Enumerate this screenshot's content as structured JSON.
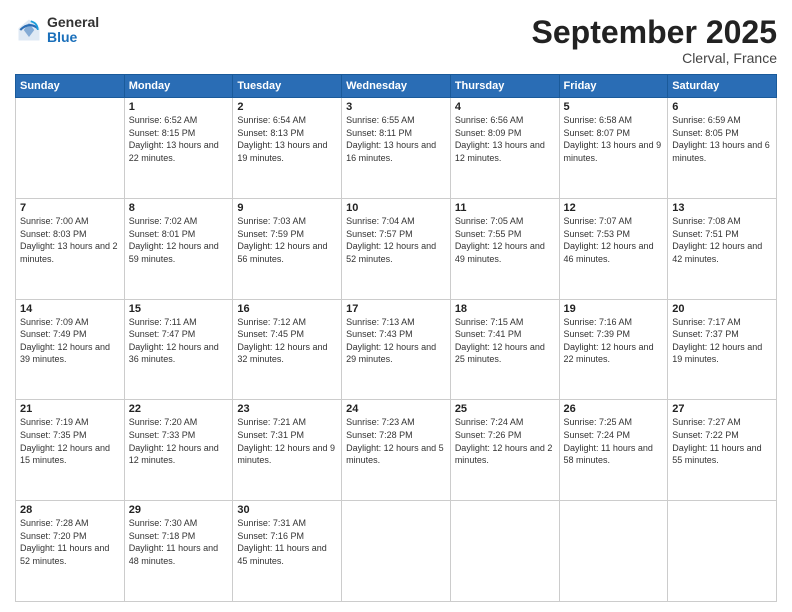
{
  "logo": {
    "general": "General",
    "blue": "Blue"
  },
  "header": {
    "month": "September 2025",
    "location": "Clerval, France"
  },
  "weekdays": [
    "Sunday",
    "Monday",
    "Tuesday",
    "Wednesday",
    "Thursday",
    "Friday",
    "Saturday"
  ],
  "weeks": [
    [
      {
        "day": "",
        "sunrise": "",
        "sunset": "",
        "daylight": ""
      },
      {
        "day": "1",
        "sunrise": "Sunrise: 6:52 AM",
        "sunset": "Sunset: 8:15 PM",
        "daylight": "Daylight: 13 hours and 22 minutes."
      },
      {
        "day": "2",
        "sunrise": "Sunrise: 6:54 AM",
        "sunset": "Sunset: 8:13 PM",
        "daylight": "Daylight: 13 hours and 19 minutes."
      },
      {
        "day": "3",
        "sunrise": "Sunrise: 6:55 AM",
        "sunset": "Sunset: 8:11 PM",
        "daylight": "Daylight: 13 hours and 16 minutes."
      },
      {
        "day": "4",
        "sunrise": "Sunrise: 6:56 AM",
        "sunset": "Sunset: 8:09 PM",
        "daylight": "Daylight: 13 hours and 12 minutes."
      },
      {
        "day": "5",
        "sunrise": "Sunrise: 6:58 AM",
        "sunset": "Sunset: 8:07 PM",
        "daylight": "Daylight: 13 hours and 9 minutes."
      },
      {
        "day": "6",
        "sunrise": "Sunrise: 6:59 AM",
        "sunset": "Sunset: 8:05 PM",
        "daylight": "Daylight: 13 hours and 6 minutes."
      }
    ],
    [
      {
        "day": "7",
        "sunrise": "Sunrise: 7:00 AM",
        "sunset": "Sunset: 8:03 PM",
        "daylight": "Daylight: 13 hours and 2 minutes."
      },
      {
        "day": "8",
        "sunrise": "Sunrise: 7:02 AM",
        "sunset": "Sunset: 8:01 PM",
        "daylight": "Daylight: 12 hours and 59 minutes."
      },
      {
        "day": "9",
        "sunrise": "Sunrise: 7:03 AM",
        "sunset": "Sunset: 7:59 PM",
        "daylight": "Daylight: 12 hours and 56 minutes."
      },
      {
        "day": "10",
        "sunrise": "Sunrise: 7:04 AM",
        "sunset": "Sunset: 7:57 PM",
        "daylight": "Daylight: 12 hours and 52 minutes."
      },
      {
        "day": "11",
        "sunrise": "Sunrise: 7:05 AM",
        "sunset": "Sunset: 7:55 PM",
        "daylight": "Daylight: 12 hours and 49 minutes."
      },
      {
        "day": "12",
        "sunrise": "Sunrise: 7:07 AM",
        "sunset": "Sunset: 7:53 PM",
        "daylight": "Daylight: 12 hours and 46 minutes."
      },
      {
        "day": "13",
        "sunrise": "Sunrise: 7:08 AM",
        "sunset": "Sunset: 7:51 PM",
        "daylight": "Daylight: 12 hours and 42 minutes."
      }
    ],
    [
      {
        "day": "14",
        "sunrise": "Sunrise: 7:09 AM",
        "sunset": "Sunset: 7:49 PM",
        "daylight": "Daylight: 12 hours and 39 minutes."
      },
      {
        "day": "15",
        "sunrise": "Sunrise: 7:11 AM",
        "sunset": "Sunset: 7:47 PM",
        "daylight": "Daylight: 12 hours and 36 minutes."
      },
      {
        "day": "16",
        "sunrise": "Sunrise: 7:12 AM",
        "sunset": "Sunset: 7:45 PM",
        "daylight": "Daylight: 12 hours and 32 minutes."
      },
      {
        "day": "17",
        "sunrise": "Sunrise: 7:13 AM",
        "sunset": "Sunset: 7:43 PM",
        "daylight": "Daylight: 12 hours and 29 minutes."
      },
      {
        "day": "18",
        "sunrise": "Sunrise: 7:15 AM",
        "sunset": "Sunset: 7:41 PM",
        "daylight": "Daylight: 12 hours and 25 minutes."
      },
      {
        "day": "19",
        "sunrise": "Sunrise: 7:16 AM",
        "sunset": "Sunset: 7:39 PM",
        "daylight": "Daylight: 12 hours and 22 minutes."
      },
      {
        "day": "20",
        "sunrise": "Sunrise: 7:17 AM",
        "sunset": "Sunset: 7:37 PM",
        "daylight": "Daylight: 12 hours and 19 minutes."
      }
    ],
    [
      {
        "day": "21",
        "sunrise": "Sunrise: 7:19 AM",
        "sunset": "Sunset: 7:35 PM",
        "daylight": "Daylight: 12 hours and 15 minutes."
      },
      {
        "day": "22",
        "sunrise": "Sunrise: 7:20 AM",
        "sunset": "Sunset: 7:33 PM",
        "daylight": "Daylight: 12 hours and 12 minutes."
      },
      {
        "day": "23",
        "sunrise": "Sunrise: 7:21 AM",
        "sunset": "Sunset: 7:31 PM",
        "daylight": "Daylight: 12 hours and 9 minutes."
      },
      {
        "day": "24",
        "sunrise": "Sunrise: 7:23 AM",
        "sunset": "Sunset: 7:28 PM",
        "daylight": "Daylight: 12 hours and 5 minutes."
      },
      {
        "day": "25",
        "sunrise": "Sunrise: 7:24 AM",
        "sunset": "Sunset: 7:26 PM",
        "daylight": "Daylight: 12 hours and 2 minutes."
      },
      {
        "day": "26",
        "sunrise": "Sunrise: 7:25 AM",
        "sunset": "Sunset: 7:24 PM",
        "daylight": "Daylight: 11 hours and 58 minutes."
      },
      {
        "day": "27",
        "sunrise": "Sunrise: 7:27 AM",
        "sunset": "Sunset: 7:22 PM",
        "daylight": "Daylight: 11 hours and 55 minutes."
      }
    ],
    [
      {
        "day": "28",
        "sunrise": "Sunrise: 7:28 AM",
        "sunset": "Sunset: 7:20 PM",
        "daylight": "Daylight: 11 hours and 52 minutes."
      },
      {
        "day": "29",
        "sunrise": "Sunrise: 7:30 AM",
        "sunset": "Sunset: 7:18 PM",
        "daylight": "Daylight: 11 hours and 48 minutes."
      },
      {
        "day": "30",
        "sunrise": "Sunrise: 7:31 AM",
        "sunset": "Sunset: 7:16 PM",
        "daylight": "Daylight: 11 hours and 45 minutes."
      },
      {
        "day": "",
        "sunrise": "",
        "sunset": "",
        "daylight": ""
      },
      {
        "day": "",
        "sunrise": "",
        "sunset": "",
        "daylight": ""
      },
      {
        "day": "",
        "sunrise": "",
        "sunset": "",
        "daylight": ""
      },
      {
        "day": "",
        "sunrise": "",
        "sunset": "",
        "daylight": ""
      }
    ]
  ]
}
